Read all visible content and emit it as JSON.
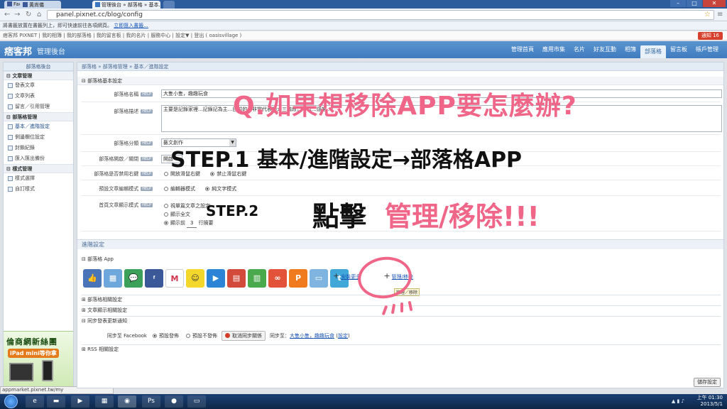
{
  "browser": {
    "tabs": [
      {
        "label": "Facebook"
      },
      {
        "label": "黃尚儀"
      },
      {
        "label": "管理後台 » 部落格 » 基本…",
        "active": true
      }
    ],
    "url": "panel.pixnet.cc/blog/config",
    "bookmark_msg": "將書籤放置在書籤列上，即可快速前往各項網頁。",
    "bookmark_link": "立即匯入書籤..."
  },
  "toplinks": {
    "items": [
      "痞客邦 PIXNET",
      "我的相簿",
      "我的部落格",
      "我的留言板",
      "我的名片",
      "服務中心",
      "設定▼",
      "登出 ( oasisvillage )"
    ],
    "notify": "通知 16"
  },
  "header": {
    "logo": "痞客邦",
    "subtitle": "管理後台",
    "nav": [
      "管理首頁",
      "應用市集",
      "名片",
      "好友互動",
      "相簿",
      "部落格",
      "留言板",
      "帳戶管理"
    ],
    "active_nav": "部落格"
  },
  "sidebar": {
    "title": "部落格後台",
    "sections": [
      {
        "label": "文章管理",
        "items": [
          "發表文章",
          "文章列表",
          "留言／引用管理"
        ]
      },
      {
        "label": "部落格管理",
        "items": [
          "基本／進階設定",
          "側邊欄位設定",
          "封鎖紀錄",
          "匯入匯出備份"
        ]
      },
      {
        "label": "樣式管理",
        "items": [
          "樣式選擇",
          "自訂樣式"
        ]
      }
    ],
    "promo_line1": "倫商網新絲團",
    "promo_line2": "iPad mini等你拿"
  },
  "status_url": "appmarket.pixnet.tw/my",
  "main": {
    "breadcrumb": "部落格 » 部落格管理 » 基本／進階設定",
    "basic_section": "部落格基本設定",
    "help": "HELP",
    "fields": {
      "name_label": "部落格名稱",
      "name_value": "大隻小隻，趣趣玩食",
      "desc_label": "部落格描述",
      "desc_value": "主要是記錄家裡...記錄記為主...目前的...非常代表的大三階段，所以...感謝...！",
      "category_label": "部落格分類",
      "category_value": "藝文創作",
      "open_label": "部落格開啟／關閉",
      "open_value": "開啟",
      "rightclick_label": "部落格是否禁用右鍵",
      "rightclick_opts": [
        "開放滑鼠右鍵",
        "禁止滑鼠右鍵"
      ],
      "editor_label": "預設文章編輯模式",
      "editor_opts": [
        "編輯器模式",
        "純文字模式"
      ],
      "display_label": "首頁文章顯示模式",
      "display_opts": [
        "視單篇文章之設定",
        "顯示全文",
        "顯示前"
      ],
      "display_lines": "3",
      "display_suffix": "行摘要"
    },
    "advanced": "進階設定",
    "app_section": "部落格 App",
    "install_more": "安裝更多",
    "manage_remove": "管理/移除",
    "tooltip": "管理／移除",
    "related_section": "部落格相關設定",
    "article_display_section": "文章顯示相關設定",
    "sync_section": "同步發表更新通知",
    "fb_label": "同步至 Facebook",
    "fb_opts": [
      "預設發佈",
      "預設不發佈"
    ],
    "fb_cancel": "取消同步關係",
    "fb_sync_prefix": "同步至：",
    "fb_sync_target": "大隻小隻，趣趣玩食",
    "fb_sync_setting": "設定",
    "rss_section": "RSS 相關設定",
    "save": "儲存設定"
  },
  "taskbar": {
    "time": "上午 01:30",
    "date": "2013/5/1"
  },
  "annotations": {
    "question": "Q.如果想移除APP要怎麼辦?",
    "step1": "STEP.1 基本/進階設定→部落格APP",
    "step2_label": "STEP.2",
    "step2_verb": "點擊",
    "step2_action": "管理/移除!!!"
  },
  "colors": {
    "header_blue": "#3f7bbf",
    "annotation_pink": "#f06688"
  }
}
